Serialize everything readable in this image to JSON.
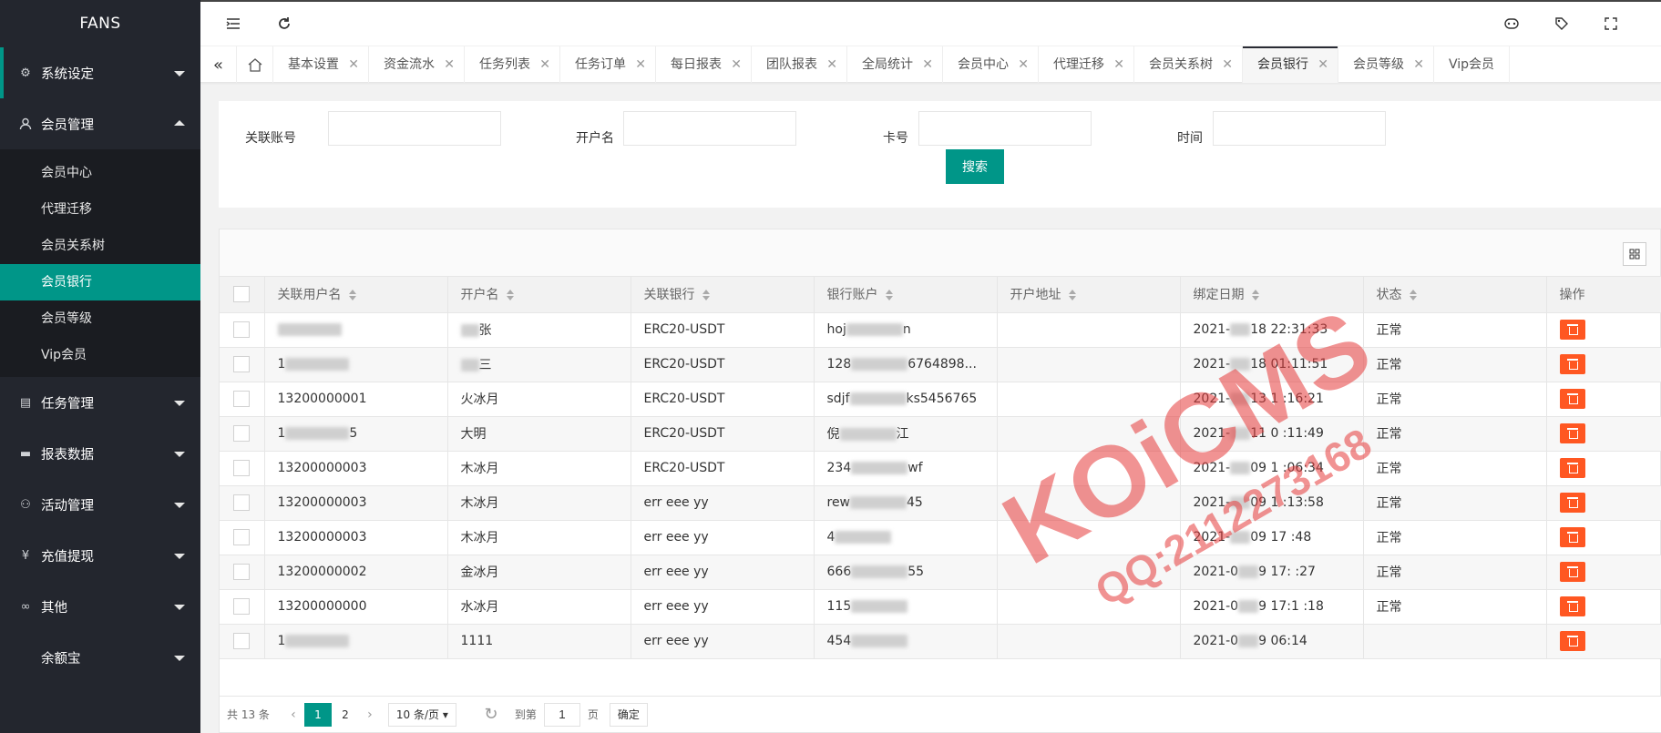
{
  "app": {
    "logo": "FANS"
  },
  "sidebar": {
    "items": [
      {
        "label": "系统设定",
        "icon": "gear-icon"
      },
      {
        "label": "会员管理",
        "icon": "user-icon",
        "expanded": true,
        "children": [
          "会员中心",
          "代理迁移",
          "会员关系树",
          "会员银行",
          "会员等级",
          "Vip会员"
        ],
        "active_child": "会员银行"
      },
      {
        "label": "任务管理",
        "icon": "doc-icon"
      },
      {
        "label": "报表数据",
        "icon": "chat-icon"
      },
      {
        "label": "活动管理",
        "icon": "group-icon"
      },
      {
        "label": "充值提现",
        "icon": "yen-icon"
      },
      {
        "label": "其他",
        "icon": "link-icon"
      },
      {
        "label": "余额宝",
        "icon": ""
      }
    ]
  },
  "header": {
    "left_buttons": [
      "menu-fold-icon",
      "refresh-icon"
    ],
    "right_buttons": [
      "theme-icon",
      "tag-icon",
      "fullscreen-icon"
    ]
  },
  "tabs": {
    "items": [
      "基本设置",
      "资金流水",
      "任务列表",
      "任务订单",
      "每日报表",
      "团队报表",
      "全局统计",
      "会员中心",
      "代理迁移",
      "会员关系树",
      "会员银行",
      "会员等级",
      "Vip会员"
    ],
    "active": "会员银行"
  },
  "search": {
    "fields": [
      {
        "label": "关联账号",
        "value": ""
      },
      {
        "label": "开户名",
        "value": ""
      },
      {
        "label": "卡号",
        "value": ""
      },
      {
        "label": "时间",
        "value": ""
      }
    ],
    "button": "搜索"
  },
  "table": {
    "columns": [
      "关联用户名",
      "开户名",
      "关联银行",
      "银行账户",
      "开户地址",
      "绑定日期",
      "状态",
      "操作"
    ],
    "rows": [
      {
        "user": "",
        "name": "张",
        "bank": "ERC20-USDT",
        "account": "hoj",
        "account_tail": "n",
        "address": "",
        "date": "2021-",
        "date_tail": "18 22:31:33",
        "status": "正常"
      },
      {
        "user": "1",
        "name": "三",
        "bank": "ERC20-USDT",
        "account": "128",
        "account_tail": "6764898...",
        "address": "",
        "date": "2021-",
        "date_tail": "18 01:11:51",
        "status": "正常"
      },
      {
        "user": "13200000001",
        "name": "火冰月",
        "bank": "ERC20-USDT",
        "account": "sdjf",
        "account_tail": "ks5456765",
        "address": "",
        "date": "2021-",
        "date_tail": "13 1 :16:21",
        "status": "正常"
      },
      {
        "user": "1",
        "user_tail": "5",
        "name": "大明",
        "bank": "ERC20-USDT",
        "account": "倪",
        "account_tail": "江",
        "address": "",
        "date": "2021-",
        "date_tail": "11 0 :11:49",
        "status": "正常"
      },
      {
        "user": "13200000003",
        "name": "木冰月",
        "bank": "ERC20-USDT",
        "account": "234",
        "account_tail": "wf",
        "address": "",
        "date": "2021-",
        "date_tail": "09 1 :06:34",
        "status": "正常"
      },
      {
        "user": "13200000003",
        "name": "木冰月",
        "bank": "err eee yy",
        "account": "rew",
        "account_tail": "45",
        "address": "",
        "date": "2021-",
        "date_tail": "09 1 :13:58",
        "status": "正常"
      },
      {
        "user": "13200000003",
        "name": "木冰月",
        "bank": "err eee yy",
        "account": "4",
        "account_tail": "",
        "address": "",
        "date": "2021-",
        "date_tail": "09 17 :48",
        "status": "正常"
      },
      {
        "user": "13200000002",
        "name": "金冰月",
        "bank": "err eee yy",
        "account": "666",
        "account_tail": "55",
        "address": "",
        "date": "2021-0",
        "date_tail": "9 17: :27",
        "status": "正常"
      },
      {
        "user": "13200000000",
        "name": "水冰月",
        "bank": "err eee yy",
        "account": "115",
        "account_tail": "",
        "address": "",
        "date": "2021-0",
        "date_tail": "9 17:1 :18",
        "status": "正常"
      },
      {
        "user": "1",
        "name": "1111",
        "bank": "err eee yy",
        "account": "454",
        "account_tail": "",
        "address": "",
        "date": "2021-0",
        "date_tail": "9 06:14",
        "status": ""
      }
    ]
  },
  "pager": {
    "total": "共 13 条",
    "pages": [
      "1",
      "2"
    ],
    "current": "1",
    "page_size": "10 条/页",
    "goto_label": "到第",
    "goto_value": "1",
    "page_unit": "页",
    "confirm": "确定"
  },
  "watermark": {
    "brand": "KOiCMS",
    "qq": "QQ:2112273168"
  },
  "colors": {
    "accent": "#009688",
    "sidebar": "#23262e",
    "danger": "#ff5722"
  }
}
